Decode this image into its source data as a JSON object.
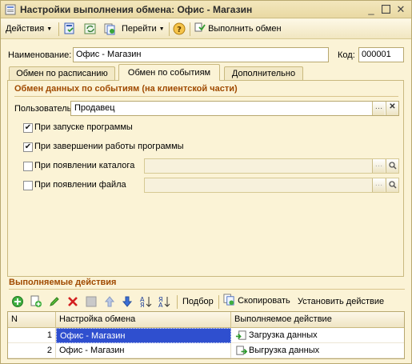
{
  "window": {
    "title": "Настройки выполнения обмена: Офис - Магазин"
  },
  "toolbar": {
    "actions_label": "Действия",
    "goto_label": "Перейти",
    "execute_label": "Выполнить обмен"
  },
  "form": {
    "name_label": "Наименование:",
    "name_value": "Офис - Магазин",
    "code_label": "Код:",
    "code_value": "000001"
  },
  "tabs": [
    {
      "label": "Обмен по расписанию"
    },
    {
      "label": "Обмен по событиям",
      "active": true
    },
    {
      "label": "Дополнительно"
    }
  ],
  "events_group": {
    "title": "Обмен данных по событиям (на клиентской части)",
    "user_label": "Пользователь:",
    "user_value": "Продавец",
    "checkboxes": [
      {
        "label": "При запуске программы",
        "checked": true
      },
      {
        "label": "При завершении работы программы",
        "checked": true
      },
      {
        "label": "При появлении каталога",
        "checked": false
      },
      {
        "label": "При появлении файла",
        "checked": false
      }
    ]
  },
  "actions_section": {
    "title": "Выполняемые действия",
    "picker_label": "Подбор",
    "copy_label": "Скопировать",
    "set_action_label": "Установить действие",
    "columns": [
      "N",
      "Настройка обмена",
      "Выполняемое действие"
    ],
    "rows": [
      {
        "n": "1",
        "setting": "Офис - Магазин",
        "action": "Загрузка данных"
      },
      {
        "n": "2",
        "setting": "Офис - Магазин",
        "action": "Выгрузка данных"
      }
    ]
  },
  "icons": {
    "title": "exchange-settings-icon",
    "accent": "#2f4fcf",
    "group_title_color": "#a04a00"
  }
}
